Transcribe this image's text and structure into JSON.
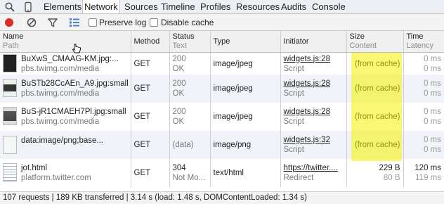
{
  "tabs": [
    "Elements",
    "Network",
    "Sources",
    "Timeline",
    "Profiles",
    "Resources",
    "Audits",
    "Console"
  ],
  "toolbar": {
    "preserve_log": "Preserve log",
    "disable_cache": "Disable cache"
  },
  "columns": {
    "name": {
      "l1": "Name",
      "l2": "Path"
    },
    "method": {
      "l1": "Method"
    },
    "status": {
      "l1": "Status",
      "l2": "Text"
    },
    "type": {
      "l1": "Type"
    },
    "initiator": {
      "l1": "Initiator"
    },
    "size": {
      "l1": "Size",
      "l2": "Content"
    },
    "time": {
      "l1": "Time",
      "l2": "Latency"
    }
  },
  "rows": [
    {
      "name": "BuXwS_CMAAG-KM.jpg:...",
      "path": "pbs.twimg.com/media",
      "method": "GET",
      "status": "200",
      "status_text": "OK",
      "type": "image/jpeg",
      "initiator": "widgets.js:28",
      "initiator_type": "Script",
      "size": "(from cache)",
      "time": "0 ms",
      "latency": "0 ms"
    },
    {
      "name": "BuSTb28CcAEn_A9.jpg:small",
      "path": "pbs.twimg.com/media",
      "method": "GET",
      "status": "200",
      "status_text": "OK",
      "type": "image/jpeg",
      "initiator": "widgets.js:28",
      "initiator_type": "Script",
      "size": "(from cache)",
      "time": "0 ms",
      "latency": "0 ms"
    },
    {
      "name": "BuS-jR1CMAEH7Pl.jpg:small",
      "path": "pbs.twimg.com/media",
      "method": "GET",
      "status": "200",
      "status_text": "OK",
      "type": "image/jpeg",
      "initiator": "widgets.js:28",
      "initiator_type": "Script",
      "size": "(from cache)",
      "time": "0 ms",
      "latency": "0 ms"
    },
    {
      "name": "data:image/png;base...",
      "path": "",
      "method": "GET",
      "status": "(data)",
      "status_text": "",
      "type": "image/png",
      "initiator": "widgets.js:32",
      "initiator_type": "Script",
      "size": "(from cache)",
      "time": "0 ms",
      "latency": "0 ms"
    },
    {
      "name": "jot.html",
      "path": "platform.twitter.com",
      "method": "GET",
      "status": "304",
      "status_text": "Not Mo...",
      "type": "text/html",
      "initiator": "https://twitter....",
      "initiator_type": "Redirect",
      "size": "229 B",
      "content": "80 B",
      "time": "120 ms",
      "latency": "119 ms"
    }
  ],
  "statusbar": "107 requests | 189 KB transferred | 3.14 s (load: 1.48 s, DOMContentLoaded: 1.34 s)",
  "colors": {
    "record": "#d93025",
    "highlight": "#f5f200",
    "filter_blue": "#4a7fd6"
  }
}
